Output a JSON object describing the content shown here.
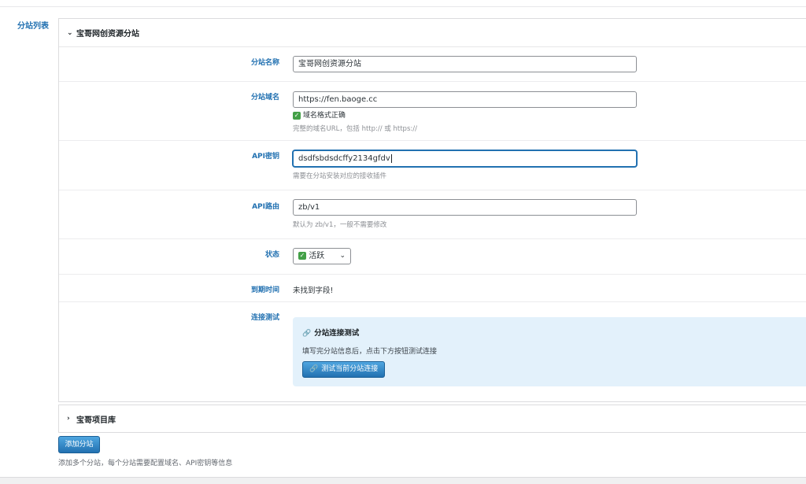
{
  "side_label": "分站列表",
  "site_panel": {
    "title": "宝哥网创资源分站",
    "fields": {
      "name": {
        "label": "分站名称",
        "value": "宝哥网创资源分站"
      },
      "domain": {
        "label": "分站域名",
        "value": "https://fen.baoge.cc",
        "valid_text": "域名格式正确",
        "hint": "完整的域名URL，包括 http:// 或 https://"
      },
      "api_key": {
        "label": "API密钥",
        "value": "dsdfsbdsdcffy2134gfdv",
        "hint": "需要在分站安装对应的接收插件"
      },
      "api_route": {
        "label": "API路由",
        "value": "zb/v1",
        "hint": "默认为 zb/v1，一般不需要修改"
      },
      "status": {
        "label": "状态",
        "value": "活跃"
      },
      "expire": {
        "label": "到期时间",
        "value": "未找到字段!"
      },
      "connection": {
        "label": "连接测试",
        "box_title": "分站连接测试",
        "box_desc": "填写完分站信息后，点击下方按钮测试连接",
        "button": "测试当前分站连接"
      }
    }
  },
  "second_panel": {
    "title": "宝哥项目库"
  },
  "add_button": "添加分站",
  "footer_hint": "添加多个分站，每个分站需要配置域名、API密钥等信息",
  "colors": {
    "accent": "#2271b1",
    "check": "#43a047",
    "test_bg": "#e3f1fb"
  },
  "icons": {
    "expand": "chevron-down-icon",
    "collapsed": "chevron-right-icon",
    "link": "link-icon",
    "check": "checkbox-checked-icon"
  }
}
